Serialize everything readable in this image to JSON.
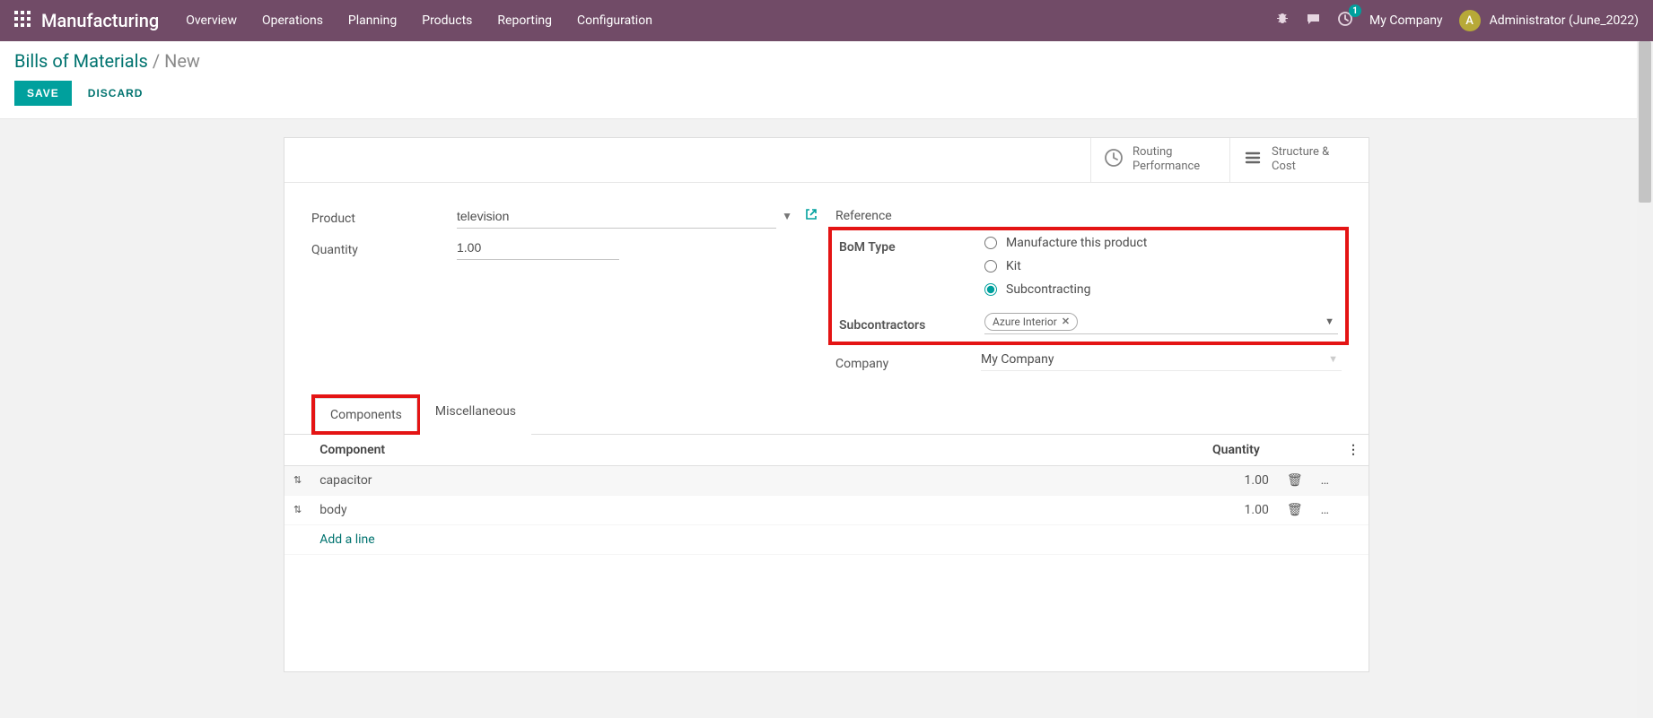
{
  "nav": {
    "brand": "Manufacturing",
    "items": [
      "Overview",
      "Operations",
      "Planning",
      "Products",
      "Reporting",
      "Configuration"
    ],
    "badge_count": "1",
    "company": "My Company",
    "avatar_initial": "A",
    "user": "Administrator (June_2022)"
  },
  "breadcrumb": {
    "root": "Bills of Materials",
    "sep": "/",
    "current": "New"
  },
  "actions": {
    "save": "SAVE",
    "discard": "DISCARD"
  },
  "stat_buttons": {
    "routing": "Routing\nPerformance",
    "structure": "Structure &\nCost"
  },
  "form": {
    "product_label": "Product",
    "product_value": "television",
    "quantity_label": "Quantity",
    "quantity_value": "1.00",
    "reference_label": "Reference",
    "bom_type_label": "BoM Type",
    "bom_type_options": {
      "mfg": "Manufacture this product",
      "kit": "Kit",
      "sub": "Subcontracting"
    },
    "bom_type_selected": "sub",
    "subcontractors_label": "Subcontractors",
    "subcontractors_tag": "Azure Interior",
    "company_label": "Company",
    "company_value": "My Company"
  },
  "tabs": {
    "components": "Components",
    "misc": "Miscellaneous"
  },
  "table": {
    "col_component": "Component",
    "col_quantity": "Quantity",
    "rows": [
      {
        "component": "capacitor",
        "quantity": "1.00"
      },
      {
        "component": "body",
        "quantity": "1.00"
      }
    ],
    "add_line": "Add a line"
  }
}
